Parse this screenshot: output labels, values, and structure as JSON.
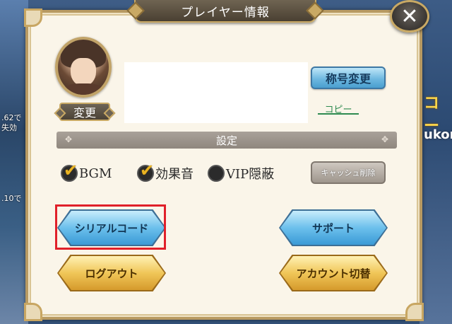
{
  "title": "プレイヤー情報",
  "profile": {
    "change_label": "変更",
    "title_change_label": "称号変更",
    "copy_label": "コピー"
  },
  "settings": {
    "header": "設定",
    "options": [
      {
        "label": "BGM",
        "checked": true
      },
      {
        "label": "効果音",
        "checked": true
      },
      {
        "label": "VIP隠蔽",
        "checked": false
      }
    ],
    "cache_clear_label": "キャッシュ削除"
  },
  "actions": {
    "serial_code_label": "シリアルコード",
    "support_label": "サポート",
    "logout_label": "ログアウト",
    "account_switch_label": "アカウント切替"
  },
  "background": {
    "left_text_1": ".62で",
    "left_text_2": "失効",
    "left_text_3": ".10で",
    "right_text_1": "コー",
    "right_text_2": "ukor"
  },
  "colors": {
    "accent_blue": "#6cc0ec",
    "accent_gold": "#f0c658",
    "highlight_red": "#e0202a",
    "panel_bg": "#faf5e9"
  }
}
